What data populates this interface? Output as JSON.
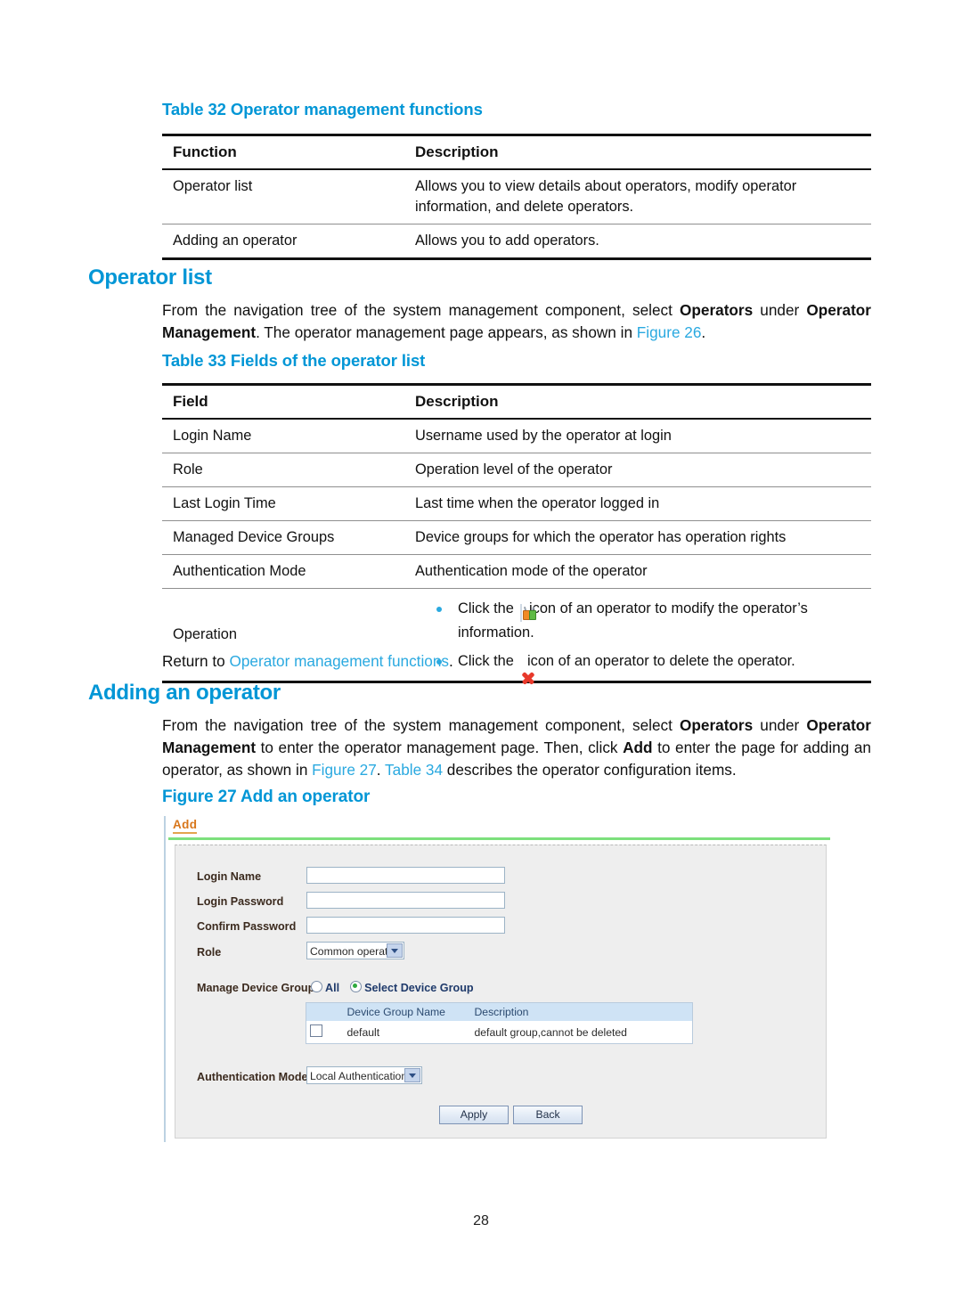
{
  "page": {
    "number": "28"
  },
  "table32": {
    "title": "Table 32 Operator management functions",
    "headers": [
      "Function",
      "Description"
    ],
    "rows": [
      {
        "function": "Operator list",
        "description": "Allows you to view details about operators, modify operator information, and delete operators."
      },
      {
        "function": "Adding an operator",
        "description": "Allows you to add operators."
      }
    ]
  },
  "section_operator_list": {
    "heading": "Operator list",
    "paragraph": {
      "part1": "From the navigation tree of the system management component, select ",
      "bold1": "Operators",
      "part2": " under ",
      "bold2": "Operator Management",
      "part3": ". The operator management page appears, as shown in ",
      "link1": "Figure 26",
      "part4": "."
    }
  },
  "table33": {
    "title": "Table 33 Fields of the operator list",
    "headers": [
      "Field",
      "Description"
    ],
    "rows": [
      {
        "field": "Login Name",
        "description": "Username used by the operator at login"
      },
      {
        "field": "Role",
        "description": "Operation level of the operator"
      },
      {
        "field": "Last Login Time",
        "description": "Last time when the operator logged in"
      },
      {
        "field": "Managed Device Groups",
        "description": "Device groups for which the operator has operation rights"
      },
      {
        "field": "Authentication Mode",
        "description": "Authentication mode of the operator"
      }
    ],
    "operation_row": {
      "field": "Operation",
      "bullet1_before": "Click the",
      "bullet1_icon": "modify-operator-icon",
      "bullet1_after": "icon of an operator to modify the operator’s information.",
      "bullet2_before": "Click the",
      "bullet2_icon": "delete-operator-icon",
      "bullet2_after": "icon of an operator to delete the operator."
    }
  },
  "return_line": {
    "prefix": "Return to ",
    "link": "Operator management functions",
    "suffix": "."
  },
  "section_adding_operator": {
    "heading": "Adding an operator",
    "paragraph": {
      "part1": "From the navigation tree of the system management component, select ",
      "bold1": "Operators",
      "part2": " under ",
      "bold2": "Operator Management",
      "part3": " to enter the operator management page. Then, click ",
      "bold3": "Add",
      "part4": " to enter the page for adding an operator, as shown in ",
      "link1": "Figure 27",
      "part5": ". ",
      "link2": "Table 34",
      "part6": " describes the operator configuration items."
    }
  },
  "figure27": {
    "caption": "Figure 27 Add an operator",
    "tab_label": "Add",
    "fields": {
      "login_name_label": "Login Name",
      "login_name_value": "",
      "login_password_label": "Login Password",
      "login_password_value": "",
      "confirm_password_label": "Confirm Password",
      "confirm_password_value": "",
      "role_label": "Role",
      "role_value": "Common operator",
      "manage_device_group_label": "Manage Device Group",
      "radio_all": "All",
      "radio_select": "Select Device Group",
      "auth_mode_label": "Authentication Mode",
      "auth_mode_value": "Local Authentication"
    },
    "device_group_table": {
      "headers": [
        "",
        "Device Group Name",
        "Description"
      ],
      "rows": [
        {
          "name": "default",
          "description": "default group,cannot be deleted"
        }
      ]
    },
    "buttons": {
      "apply": "Apply",
      "back": "Back"
    }
  },
  "colors": {
    "heading_blue": "#0096d6",
    "link_blue": "#2aa9e0",
    "tab_orange": "#d8761a",
    "rule_green": "#7de07d",
    "table_header_blue": "#cfe3f5"
  }
}
